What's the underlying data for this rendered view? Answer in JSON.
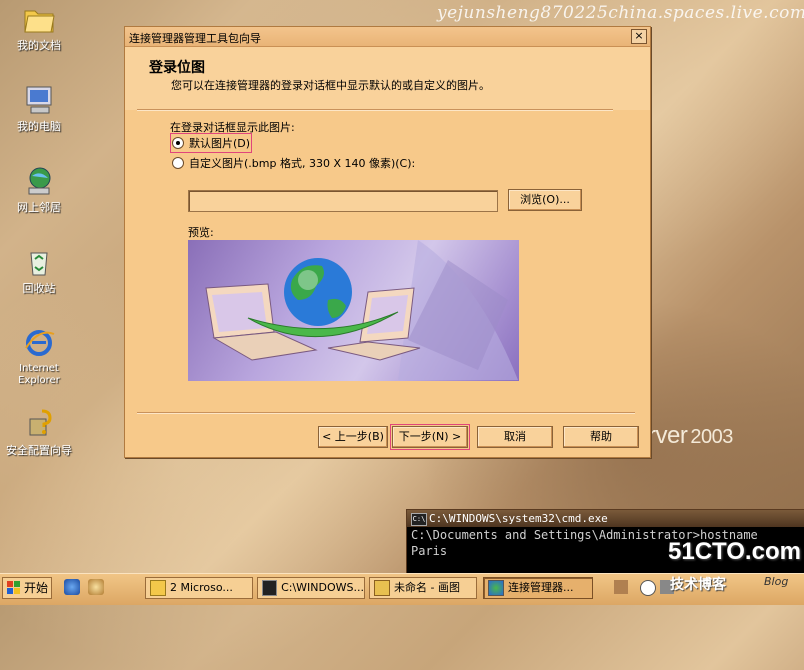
{
  "watermark": "yejunsheng870225china.spaces.live.com",
  "bg_brand": {
    "partial": "rver",
    "version": "2003"
  },
  "desktop_icons": [
    {
      "label": "我的文档"
    },
    {
      "label": "我的电脑"
    },
    {
      "label": "网上邻居"
    },
    {
      "label": "回收站"
    },
    {
      "label": "Internet Explorer"
    },
    {
      "label": "安全配置向导"
    }
  ],
  "dialog": {
    "title": "连接管理器管理工具包向导",
    "close": "×",
    "header_title": "登录位图",
    "header_subtitle": "您可以在连接管理器的登录对话框中显示默认的或自定义的图片。",
    "group_label": "在登录对话框显示此图片:",
    "option_default": "默认图片(D)",
    "option_custom": "自定义图片(.bmp 格式, 330 X 140 像素)(C):",
    "path_value": "",
    "browse_label": "浏览(O)...",
    "preview_label": "预览:",
    "back_label": "< 上一步(B)",
    "next_label": "下一步(N) >",
    "cancel_label": "取消",
    "help_label": "帮助"
  },
  "cmd": {
    "title": "C:\\WINDOWS\\system32\\cmd.exe",
    "icon_text": "C:\\",
    "lines": [
      "C:\\Documents and Settings\\Administrator>hostname",
      "Paris"
    ]
  },
  "watermarks": {
    "site": "51CTO.com",
    "sub": "技术博客",
    "blog": "Blog"
  },
  "taskbar": {
    "start_label": "开始",
    "tasks": [
      {
        "label": "2 Microso...",
        "active": false
      },
      {
        "label": "C:\\WINDOWS...",
        "active": false
      },
      {
        "label": "未命名 - 画图",
        "active": false
      },
      {
        "label": "连接管理器...",
        "active": true
      }
    ]
  },
  "colors": {
    "dialog_bg": "#f7c98a",
    "highlight": "#e0457b",
    "taskbar": "#dca764"
  }
}
